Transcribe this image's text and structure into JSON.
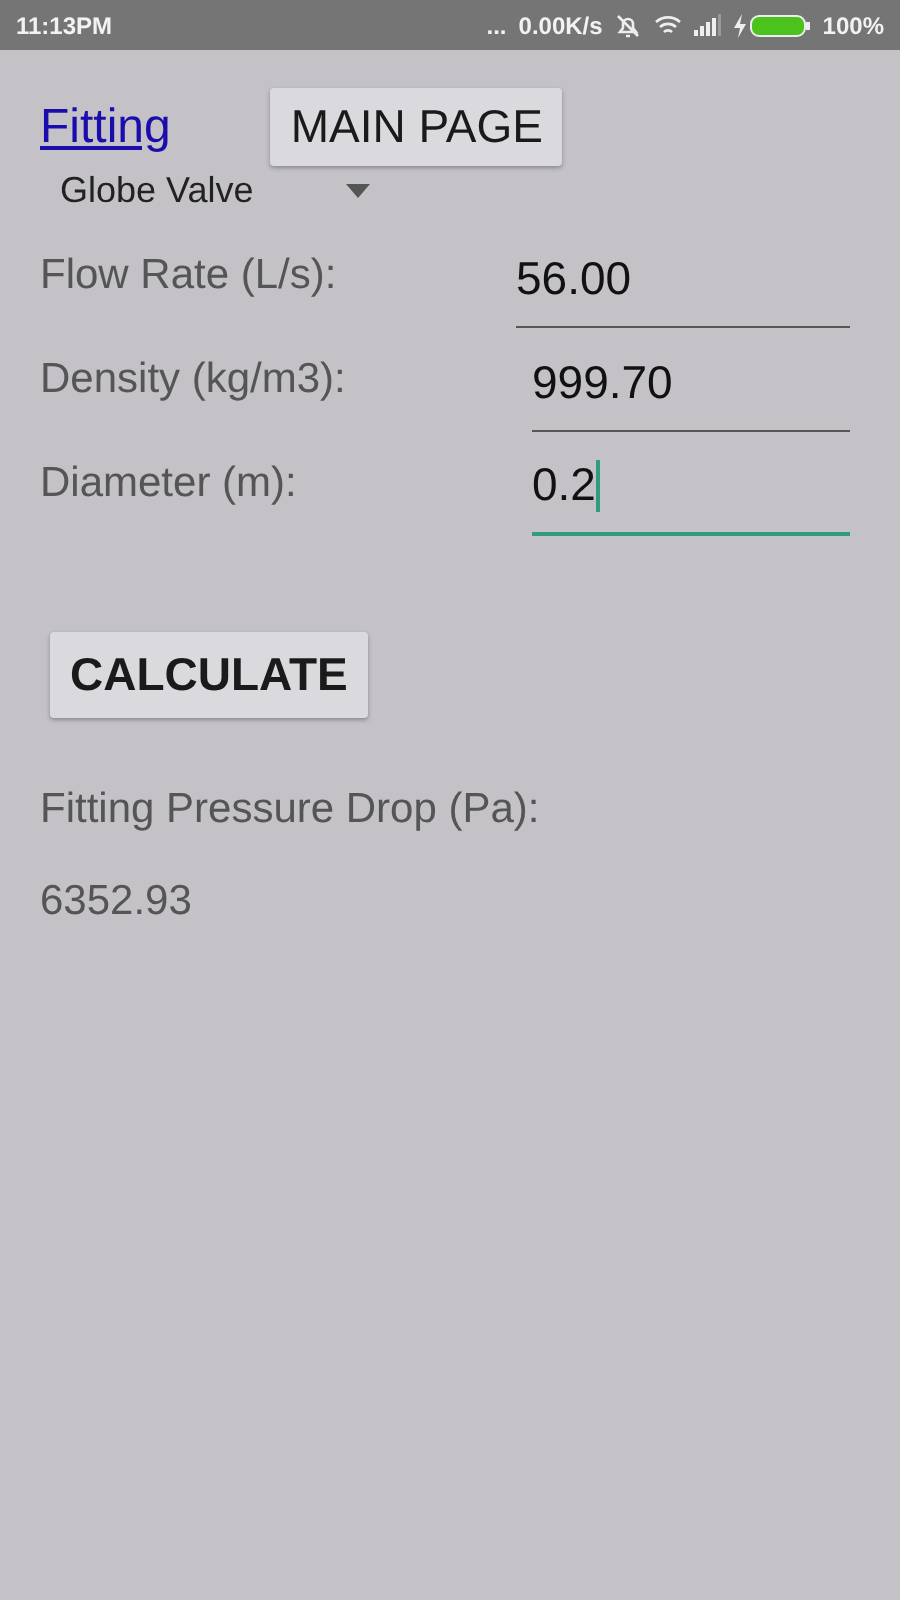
{
  "status_bar": {
    "time": "11:13PM",
    "dots": "...",
    "speed": "0.00K/s",
    "battery": "100%"
  },
  "header": {
    "link": "Fitting",
    "button": "MAIN PAGE"
  },
  "dropdown": {
    "value": "Globe Valve"
  },
  "fields": [
    {
      "label": "Flow Rate (L/s):",
      "value": "56.00",
      "focused": false
    },
    {
      "label": "Density (kg/m3):",
      "value": "999.70",
      "focused": false
    },
    {
      "label": "Diameter (m):",
      "value": "0.2",
      "focused": true
    }
  ],
  "calculate_button": "CALCULATE",
  "result": {
    "label": "Fitting Pressure Drop (Pa):",
    "value": "6352.93"
  }
}
